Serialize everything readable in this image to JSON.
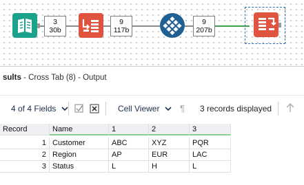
{
  "canvas": {
    "badges": [
      {
        "records": "3",
        "size": "30b"
      },
      {
        "records": "9",
        "size": "117b"
      },
      {
        "records": "9",
        "size": "207b"
      }
    ]
  },
  "results": {
    "title_prefix": "sults",
    "title_suffix": " - Cross Tab (8) - Output"
  },
  "toolbar": {
    "fields_label": "4 of 4 Fields",
    "viewer_label": "Cell Viewer",
    "records_label": "3 records displayed",
    "icons": [
      "chevron-down-icon",
      "checkbox-icon",
      "delete-icon",
      "chevron-down-icon",
      "pilcrow-icon",
      "up-arrow-icon"
    ]
  },
  "table": {
    "columns": [
      "Record",
      "Name",
      "1",
      "2",
      "3"
    ],
    "rows": [
      {
        "record": "1",
        "name": "Customer",
        "c1": "ABC",
        "c2": "XYZ",
        "c3": "PQR"
      },
      {
        "record": "2",
        "name": "Region",
        "c1": "AP",
        "c2": "EUR",
        "c3": "LAC"
      },
      {
        "record": "3",
        "name": "Status",
        "c1": "L",
        "c2": "H",
        "c3": "L"
      }
    ]
  },
  "colors": {
    "input_tool": "#1aa38a",
    "crosstab_tool": "#e0533f",
    "formula_tool": "#1f5f93",
    "header_underline": "#8ad08f"
  }
}
